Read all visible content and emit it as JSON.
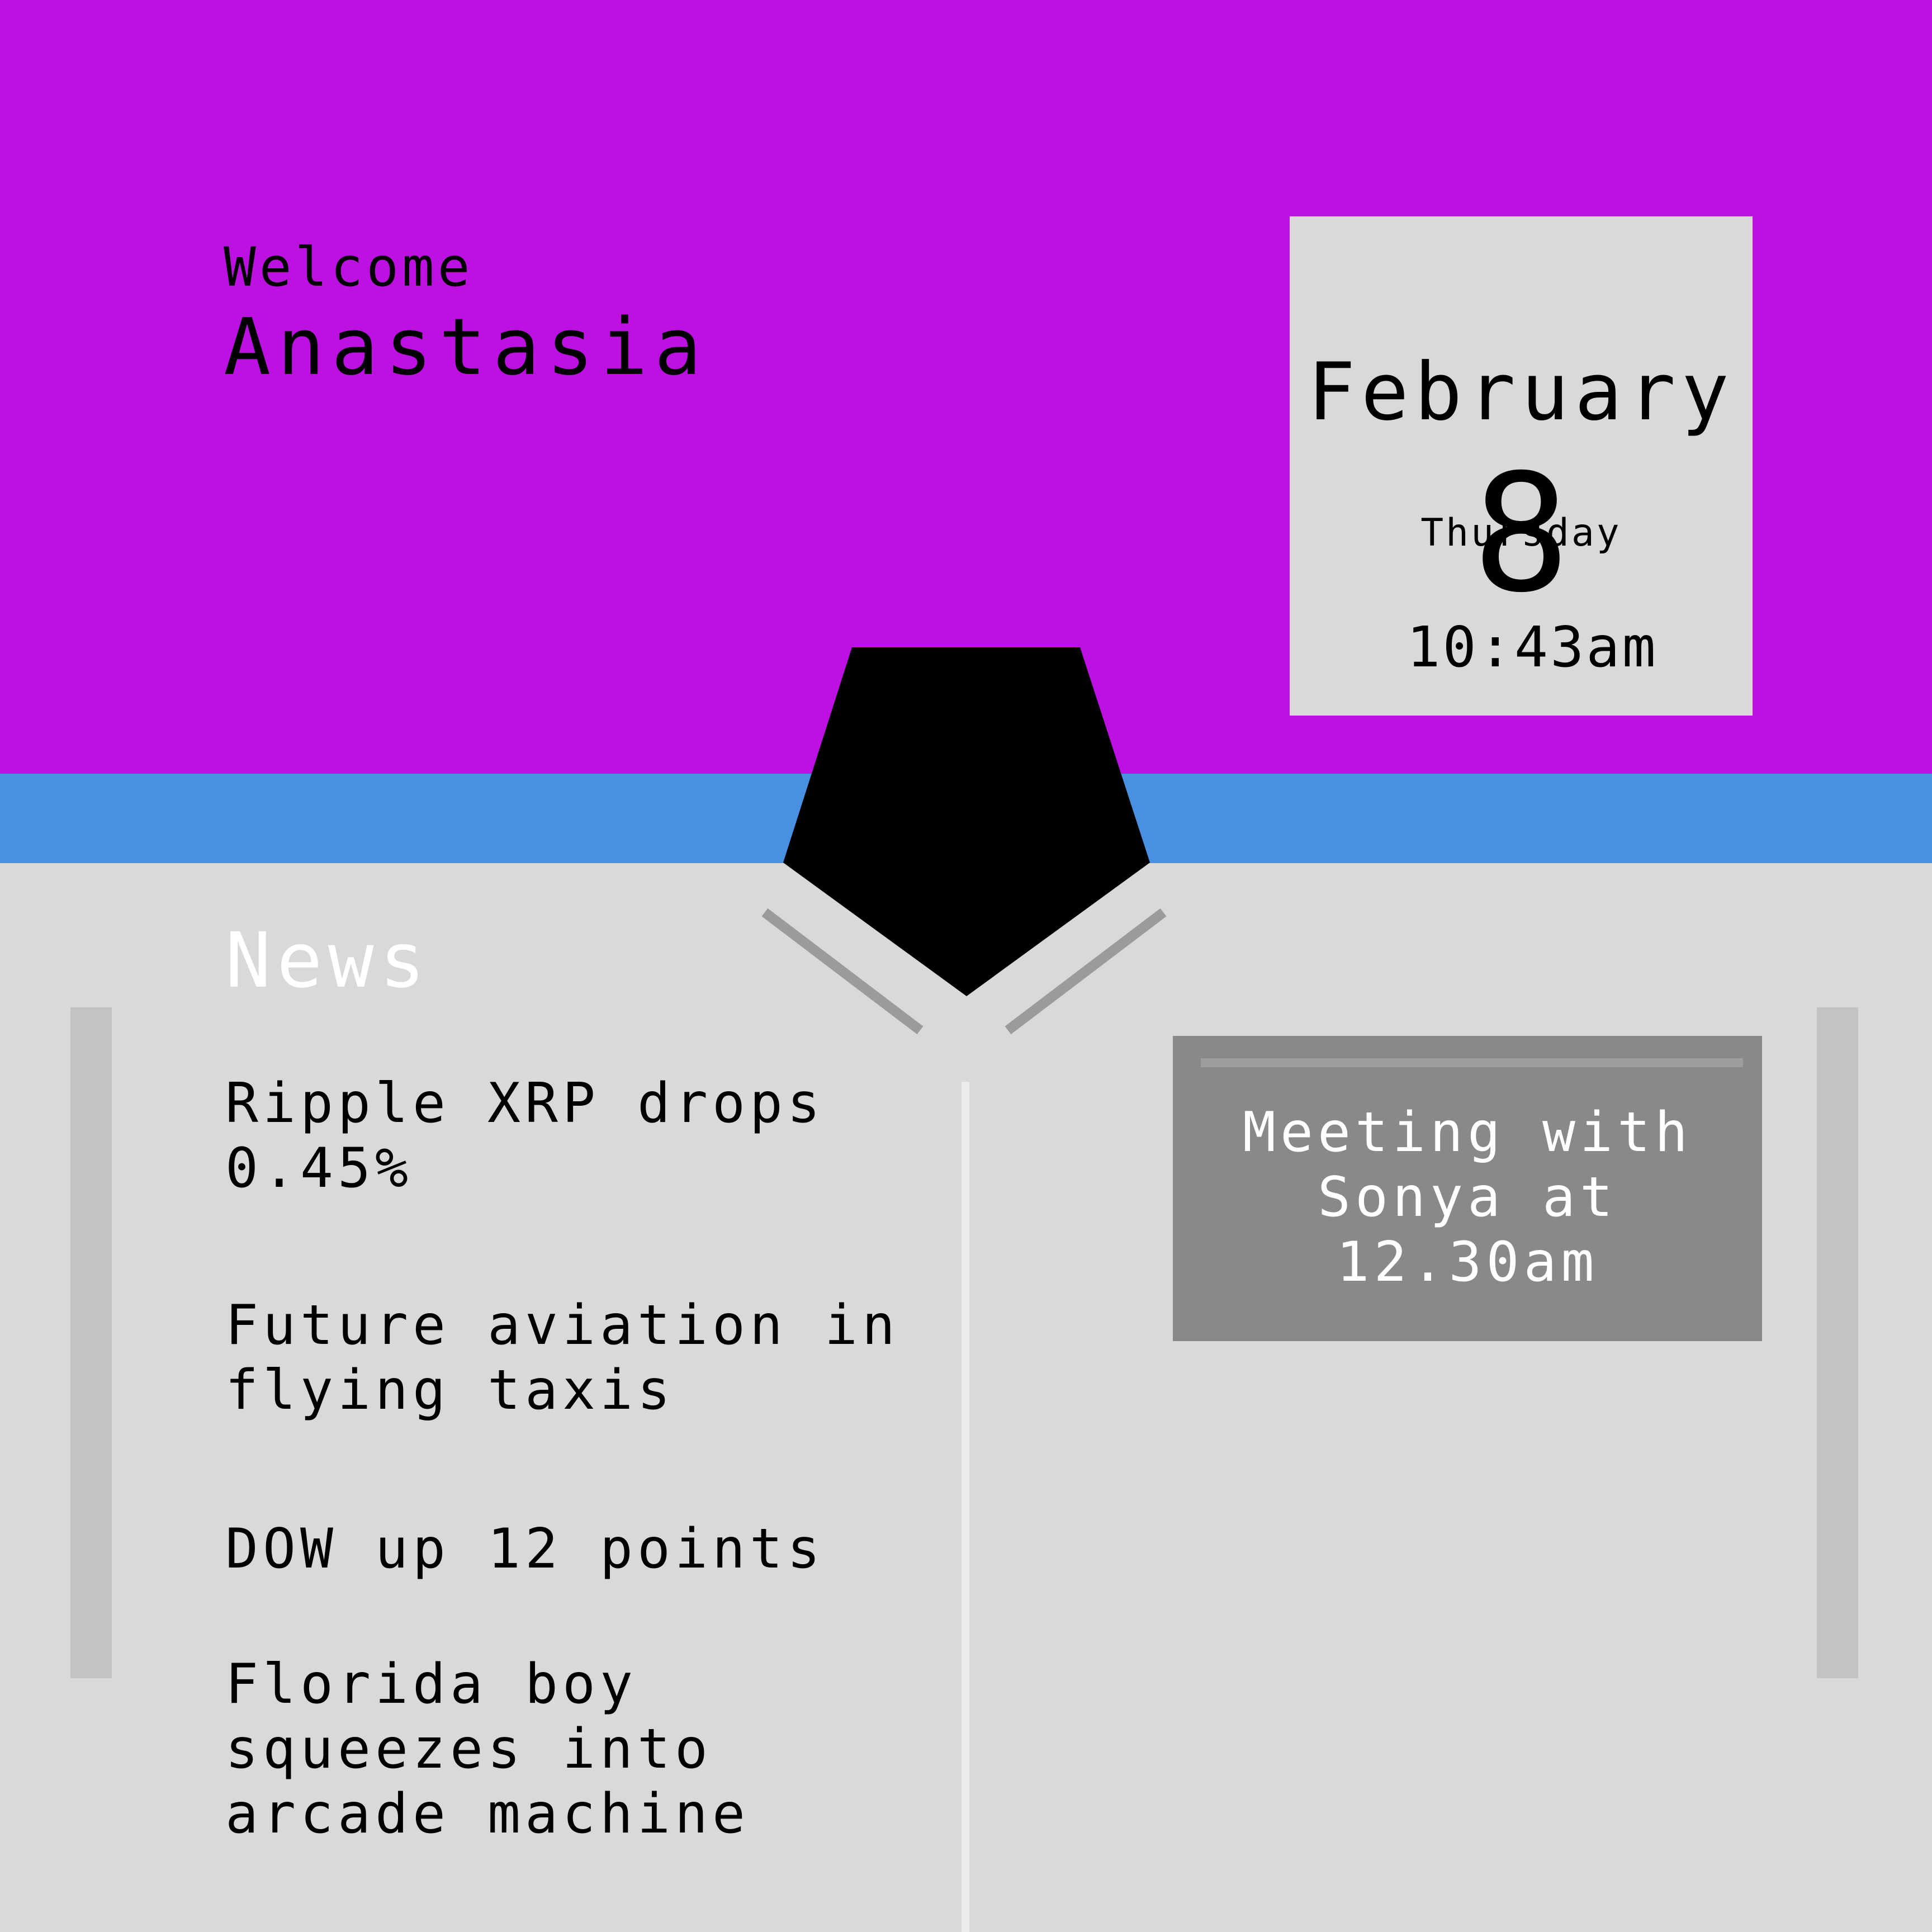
{
  "greeting": {
    "welcome": "Welcome",
    "user_name": "Anastasia"
  },
  "date_card": {
    "weekday": "Thursday",
    "month": "February",
    "day": "8",
    "time": "10:43am"
  },
  "news": {
    "title": "News",
    "items": [
      {
        "lines": [
          "Ripple XRP drops",
          "0.45%"
        ]
      },
      {
        "lines": [
          "Future aviation in",
          "flying taxis"
        ]
      },
      {
        "lines": [
          "DOW up 12 points"
        ]
      },
      {
        "lines": [
          "Florida boy",
          "squeezes into",
          "arcade machine"
        ]
      }
    ]
  },
  "meeting": {
    "lines": [
      "Meeting with",
      "Sonya at",
      "12.30am"
    ]
  },
  "icons": {
    "center": "pentagon-icon"
  },
  "colors": {
    "header": "#bc11e0",
    "band": "#4a90e2",
    "background": "#d9d9d9",
    "card": "#d9d9d9",
    "meeting_card": "#8a8987"
  }
}
